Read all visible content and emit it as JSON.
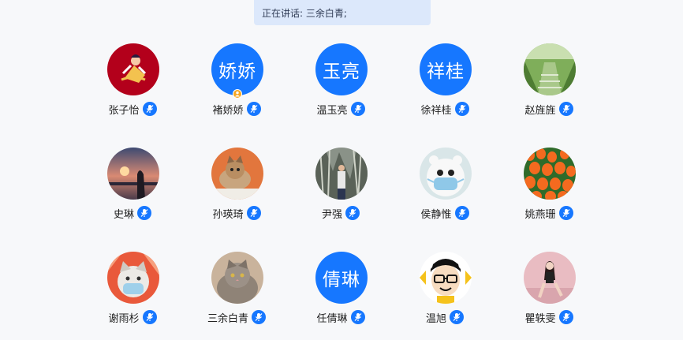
{
  "speaking": {
    "text": "正在讲话: 三余白青;"
  },
  "participants": [
    {
      "name": "张子怡",
      "avatar": "image",
      "avatar_icon": "red-illustration-avatar"
    },
    {
      "name": "褚娇娇",
      "avatar": "text",
      "avatar_text": "娇娇",
      "host": true
    },
    {
      "name": "温玉亮",
      "avatar": "text",
      "avatar_text": "玉亮"
    },
    {
      "name": "徐祥桂",
      "avatar": "text",
      "avatar_text": "祥桂"
    },
    {
      "name": "赵旌旌",
      "avatar": "image",
      "avatar_icon": "garden-photo-avatar"
    },
    {
      "name": "史琳",
      "avatar": "image",
      "avatar_icon": "sunset-girl-photo-avatar"
    },
    {
      "name": "孙瑛琦",
      "avatar": "image",
      "avatar_icon": "kitten-photo-avatar"
    },
    {
      "name": "尹强",
      "avatar": "image",
      "avatar_icon": "mountain-photo-avatar"
    },
    {
      "name": "侯静惟",
      "avatar": "image",
      "avatar_icon": "masked-bear-avatar"
    },
    {
      "name": "姚燕珊",
      "avatar": "image",
      "avatar_icon": "tulips-photo-avatar"
    },
    {
      "name": "谢雨杉",
      "avatar": "image",
      "avatar_icon": "masked-cat-avatar"
    },
    {
      "name": "三余白青",
      "avatar": "image",
      "avatar_icon": "gray-cat-photo-avatar"
    },
    {
      "name": "任倩琳",
      "avatar": "text",
      "avatar_text": "倩琳"
    },
    {
      "name": "温旭",
      "avatar": "image",
      "avatar_icon": "cartoon-boy-avatar"
    },
    {
      "name": "瞿轶雯",
      "avatar": "image",
      "avatar_icon": "woman-photo-avatar"
    }
  ],
  "colors": {
    "accent": "#1677ff",
    "host_badge": "#f5a623",
    "speaking_bg": "#dce8fb"
  }
}
